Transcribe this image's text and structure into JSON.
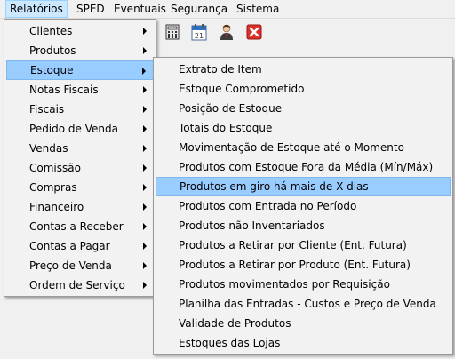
{
  "menubar": {
    "items": [
      "Relatórios",
      "SPED",
      "Eventuais",
      "Segurança",
      "Sistema"
    ]
  },
  "toolbar": {
    "icons": [
      "calculator-icon",
      "calendar-icon",
      "user-icon",
      "close-icon"
    ],
    "calendar_day": "21"
  },
  "reports_menu": {
    "items": [
      {
        "label": "Clientes"
      },
      {
        "label": "Produtos"
      },
      {
        "label": "Estoque"
      },
      {
        "label": "Notas Fiscais"
      },
      {
        "label": "Fiscais"
      },
      {
        "label": "Pedido de Venda"
      },
      {
        "label": "Vendas"
      },
      {
        "label": "Comissão"
      },
      {
        "label": "Compras"
      },
      {
        "label": "Financeiro"
      },
      {
        "label": "Contas a Receber"
      },
      {
        "label": "Contas a Pagar"
      },
      {
        "label": "Preço de Venda"
      },
      {
        "label": "Ordem de Serviço"
      }
    ]
  },
  "stock_menu": {
    "items": [
      {
        "label": "Extrato de Item"
      },
      {
        "label": "Estoque Comprometido"
      },
      {
        "label": "Posição de Estoque"
      },
      {
        "label": "Totais do Estoque"
      },
      {
        "label": "Movimentação de Estoque até o Momento"
      },
      {
        "label": "Produtos com Estoque Fora da Média (Mín/Máx)"
      },
      {
        "label": "Produtos em giro há mais de X dias"
      },
      {
        "label": "Produtos com Entrada no Período"
      },
      {
        "label": "Produtos não Inventariados"
      },
      {
        "label": "Produtos a Retirar por Cliente (Ent. Futura)"
      },
      {
        "label": "Produtos a Retirar por Produto (Ent. Futura)"
      },
      {
        "label": "Produtos movimentados por Requisição"
      },
      {
        "label": "Planilha das Entradas - Custos e Preço de Venda"
      },
      {
        "label": "Validade de Produtos"
      },
      {
        "label": "Estoques das Lojas"
      }
    ]
  }
}
